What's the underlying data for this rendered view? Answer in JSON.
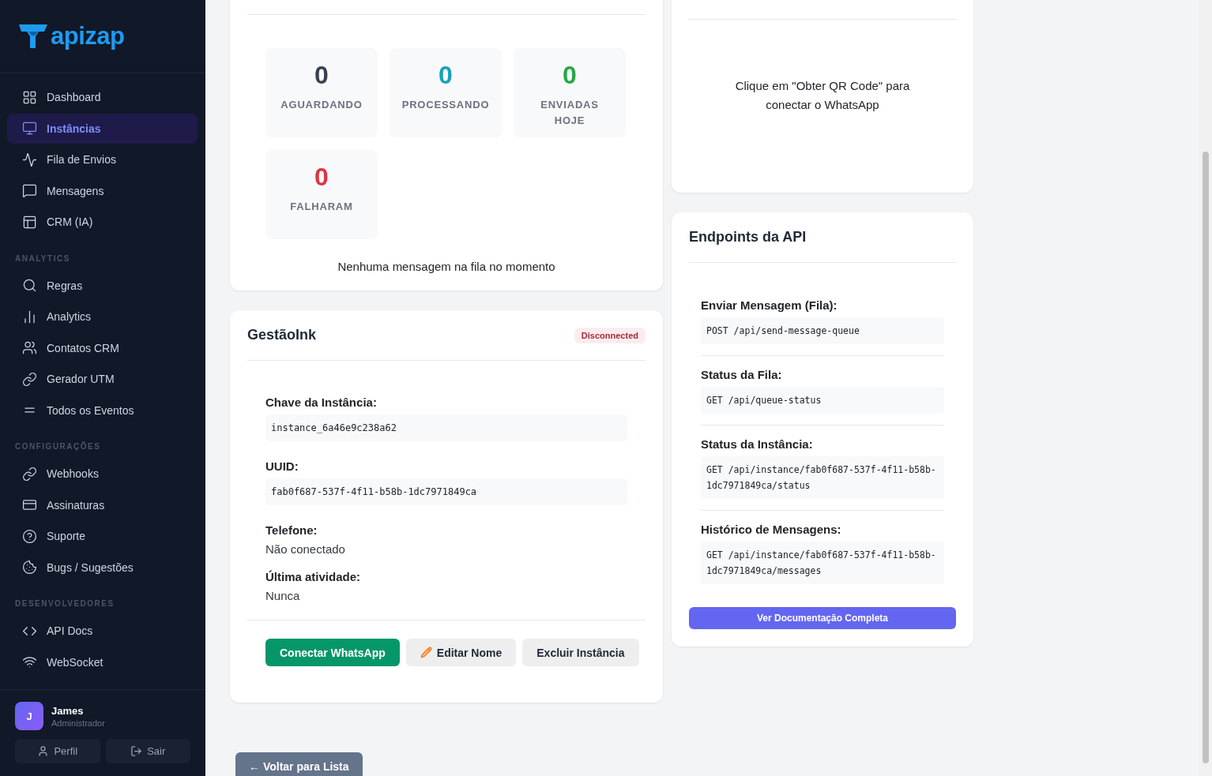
{
  "sidebar": {
    "logo": "apizap",
    "sections": [
      {
        "items": [
          {
            "label": "Dashboard",
            "selected": false
          },
          {
            "label": "Instâncias",
            "selected": true
          },
          {
            "label": "Fila de Envios",
            "selected": false
          },
          {
            "label": "Mensagens",
            "selected": false
          },
          {
            "label": "CRM (IA)",
            "selected": false
          }
        ]
      },
      {
        "title": "ANALYTICS",
        "items": [
          {
            "label": "Regras",
            "selected": false
          },
          {
            "label": "Analytics",
            "selected": false
          },
          {
            "label": "Contatos CRM",
            "selected": false
          },
          {
            "label": "Gerador UTM",
            "selected": false
          },
          {
            "label": "Todos os Eventos",
            "selected": false
          }
        ]
      },
      {
        "title": "CONFIGURAÇÕES",
        "items": [
          {
            "label": "Webhooks",
            "selected": false
          },
          {
            "label": "Assinaturas",
            "selected": false
          },
          {
            "label": "Suporte",
            "selected": false
          },
          {
            "label": "Bugs / Sugestões",
            "selected": false
          }
        ]
      },
      {
        "title": "DESENVOLVEDORES",
        "items": [
          {
            "label": "API Docs",
            "selected": false
          },
          {
            "label": "WebSocket",
            "selected": false
          }
        ]
      }
    ],
    "user": {
      "initial": "J",
      "name": "James",
      "role": "Administrador"
    },
    "user_buttons": [
      "Perfil",
      "Sair"
    ]
  },
  "queue": {
    "stats": [
      {
        "value": "0",
        "label": "AGUARDANDO",
        "color": "#374151"
      },
      {
        "value": "0",
        "label": "PROCESSANDO",
        "color": "#17a2b8"
      },
      {
        "value": "0",
        "label": "ENVIADAS HOJE",
        "color": "#28a745"
      },
      {
        "value": "0",
        "label": "FALHARAM",
        "color": "#dc3545"
      }
    ],
    "empty_message": "Nenhuma mensagem na fila no momento"
  },
  "instance": {
    "title": "GestãoInk",
    "status": "Disconnected",
    "fields": [
      {
        "label": "Chave da Instância:",
        "value": "instance_6a46e9c238a62",
        "kind": "code"
      },
      {
        "label": "UUID:",
        "value": "fab0f687-537f-4f11-b58b-1dc7971849ca",
        "kind": "code"
      },
      {
        "label": "Telefone:",
        "value": "Não conectado",
        "kind": "text"
      },
      {
        "label": "Última atividade:",
        "value": "Nunca",
        "kind": "text"
      }
    ],
    "actions": [
      {
        "label": "Conectar WhatsApp",
        "kind": "primary"
      },
      {
        "label": "Editar Nome",
        "kind": "edit"
      },
      {
        "label": "Excluir Instância",
        "kind": "secondary"
      }
    ]
  },
  "qr": {
    "message": "Clique em \"Obter QR Code\" para conectar o WhatsApp"
  },
  "endpoints": {
    "title": "Endpoints da API",
    "items": [
      {
        "label": "Enviar Mensagem (Fila):",
        "value": "POST /api/send-message-queue"
      },
      {
        "label": "Status da Fila:",
        "value": "GET /api/queue-status"
      },
      {
        "label": "Status da Instância:",
        "value": "GET /api/instance/fab0f687-537f-4f11-b58b-1dc7971849ca/status"
      },
      {
        "label": "Histórico de Mensagens:",
        "value": "GET /api/instance/fab0f687-537f-4f11-b58b-1dc7971849ca/messages"
      }
    ],
    "button": "Ver Documentação Completa"
  },
  "back_button": "← Voltar para Lista"
}
